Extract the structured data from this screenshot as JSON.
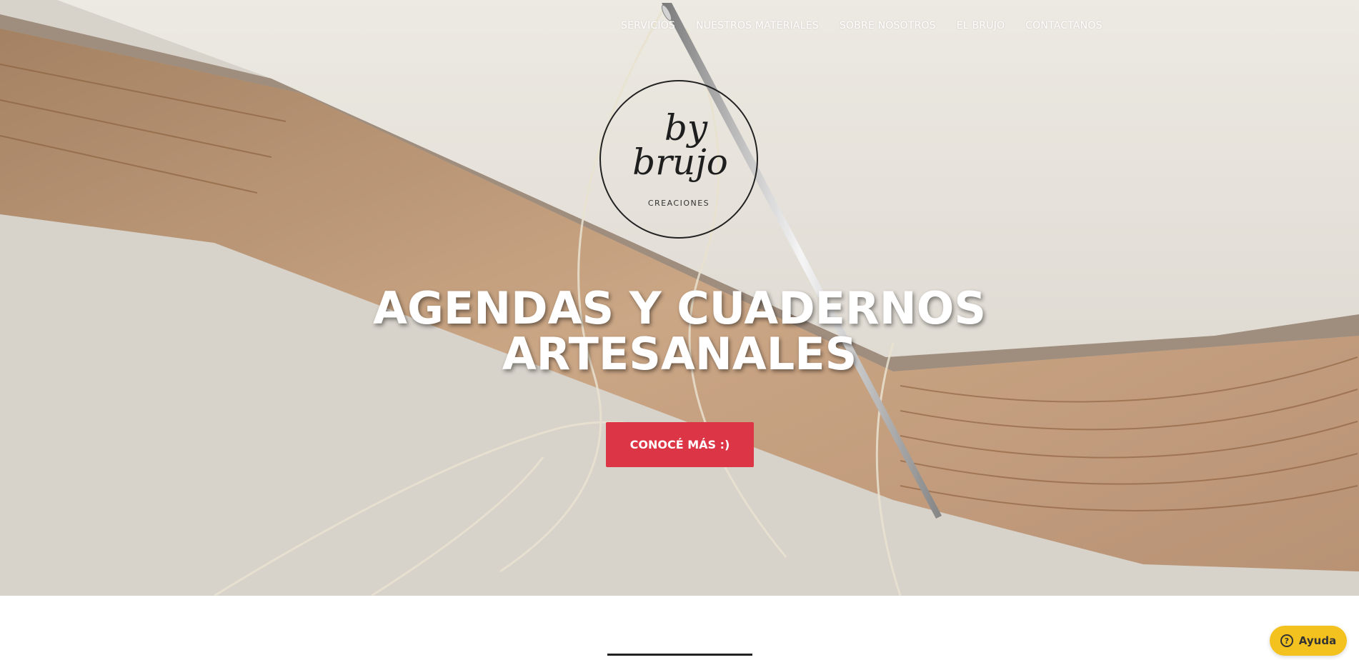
{
  "nav": {
    "items": [
      {
        "label": "SERVICIOS"
      },
      {
        "label": "NUESTROS MATERIALES"
      },
      {
        "label": "SOBRE NOSOTROS"
      },
      {
        "label": "EL BRUJO"
      },
      {
        "label": "CONTACTANOS"
      }
    ]
  },
  "logo": {
    "line1": "by",
    "line2": "brujo",
    "subtitle": "CREACIONES"
  },
  "hero": {
    "headline_line1": "AGENDAS Y CUADERNOS",
    "headline_line2": "ARTESANALES",
    "cta_label": "CONOCÉ MÁS :)"
  },
  "help": {
    "label": "Ayuda",
    "icon": "question-circle-icon"
  },
  "colors": {
    "cta": "#dc3545",
    "help": "#f4c21e",
    "text_light": "#ffffff"
  }
}
